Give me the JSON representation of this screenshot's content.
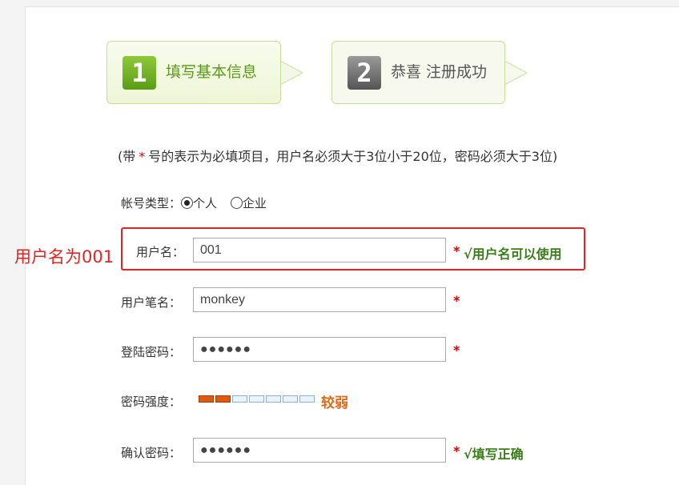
{
  "steps": [
    {
      "number": "1",
      "label": "填写基本信息",
      "state": "active"
    },
    {
      "number": "2",
      "label": "恭喜 注册成功",
      "state": "inactive"
    }
  ],
  "note": {
    "prefix": "(带",
    "star": "*",
    "suffix": "号的表示为必填项目，用户名必须大于3位小于20位，密码必须大于3位)"
  },
  "account_type": {
    "label": "帐号类型：",
    "options": [
      {
        "label": "个人",
        "checked": true
      },
      {
        "label": "企业",
        "checked": false
      }
    ]
  },
  "annotation": "用户名为001",
  "fields": {
    "username": {
      "label": "用户名：",
      "value": "001",
      "required": "*",
      "hint": "√用户名可以使用"
    },
    "nickname": {
      "label": "用户笔名：",
      "value": "monkey",
      "required": "*"
    },
    "password": {
      "label": "登陆密码：",
      "value": "●●●●●●",
      "required": "*"
    },
    "strength": {
      "label": "密码强度：",
      "level": 2,
      "segments": 7,
      "text": "较弱"
    },
    "confirm": {
      "label": "确认密码：",
      "value": "●●●●●●",
      "required": "*",
      "hint": "√填写正确"
    }
  },
  "colors": {
    "accent_green": "#5a9a1b",
    "error_red": "#e02424",
    "strength_orange": "#e06a14"
  }
}
